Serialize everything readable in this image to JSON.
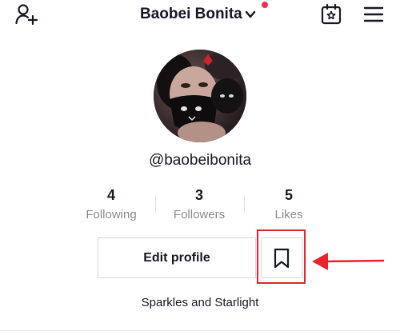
{
  "header": {
    "title": "Baobei Bonita",
    "notification_dot_color": "#fe2c55",
    "icons": [
      "add-user-icon",
      "chevron-down-icon",
      "calendar-star-icon",
      "menu-icon"
    ]
  },
  "profile": {
    "username": "@baobeibonita",
    "bio": "Sparkles and Starlight",
    "avatar_icon": "profile-avatar"
  },
  "stats": [
    {
      "value": "4",
      "label": "Following"
    },
    {
      "value": "3",
      "label": "Followers"
    },
    {
      "value": "5",
      "label": "Likes"
    }
  ],
  "actions": {
    "edit_profile_label": "Edit profile",
    "bookmark_icon": "bookmark-icon"
  },
  "annotation": {
    "highlight_color": "#e8232c"
  }
}
